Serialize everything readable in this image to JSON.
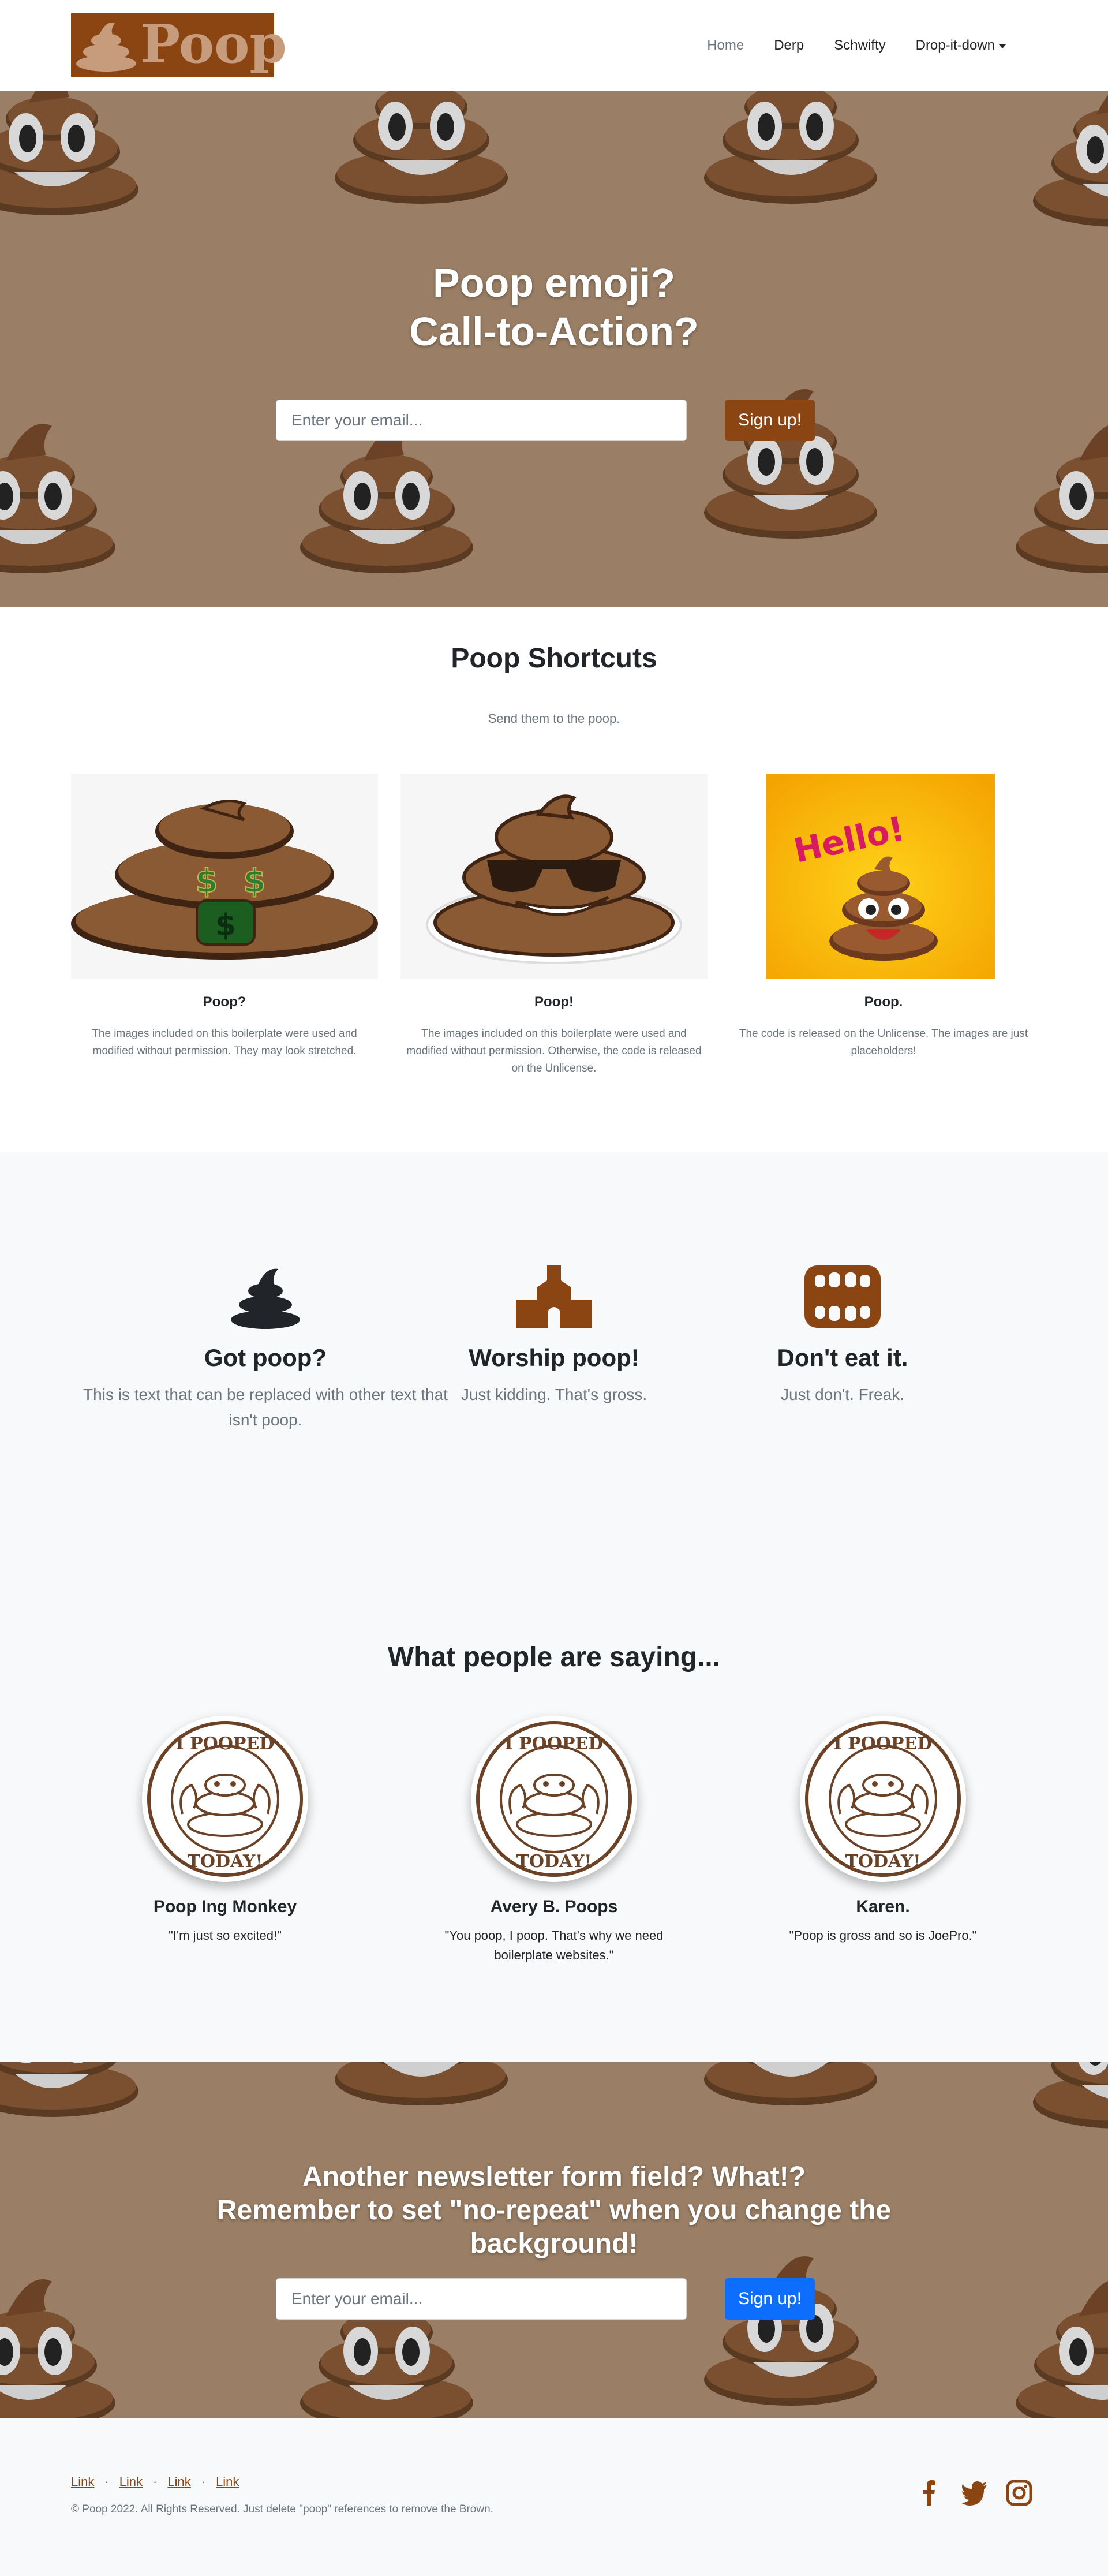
{
  "brand": {
    "logo_text": "Poop"
  },
  "nav": {
    "items": [
      {
        "label": "Home",
        "active": true
      },
      {
        "label": "Derp"
      },
      {
        "label": "Schwifty"
      },
      {
        "label": "Drop-it-down",
        "dropdown": true
      }
    ]
  },
  "hero": {
    "title_line1": "Poop emoji?",
    "title_line2": "Call-to-Action?",
    "email_placeholder": "Enter your email...",
    "button_label": "Sign up!"
  },
  "shortcuts": {
    "title": "Poop Shortcuts",
    "subtitle": "Send them to the poop.",
    "cards": [
      {
        "title": "Poop?",
        "text": "The images included on this boilerplate were used and modified without permission. They may look stretched."
      },
      {
        "title": "Poop!",
        "text": "The images included on this boilerplate were used and modified without permission. Otherwise, the code is released on the Unlicense."
      },
      {
        "title": "Poop.",
        "text": "The code is released on the Unlicense. The images are just placeholders!",
        "image_text": "Hello!"
      }
    ]
  },
  "features": [
    {
      "icon": "poop-icon",
      "title": "Got poop?",
      "text": "This is text that can be replaced with other text that isn't poop."
    },
    {
      "icon": "church-icon",
      "title": "Worship poop!",
      "text": "Just kidding. That's gross."
    },
    {
      "icon": "teeth-icon",
      "title": "Don't eat it.",
      "text": "Just don't. Freak."
    }
  ],
  "testimonials": {
    "title": "What people are saying...",
    "avatar_badge_top": "I POOPED",
    "avatar_badge_bottom": "TODAY!",
    "items": [
      {
        "name": "Poop Ing Monkey",
        "quote": "\"I'm just so excited!\""
      },
      {
        "name": "Avery B. Poops",
        "quote": "\"You poop, I poop. That's why we need boilerplate websites.\""
      },
      {
        "name": "Karen.",
        "quote": "\"Poop is gross and so is JoePro.\""
      }
    ]
  },
  "newsletter": {
    "title_line1": "Another newsletter form field? What!?",
    "title_line2": "Remember to set \"no-repeat\" when you change the",
    "title_line3": "background!",
    "email_placeholder": "Enter your email...",
    "button_label": "Sign up!"
  },
  "footer": {
    "links": [
      "Link",
      "Link",
      "Link",
      "Link"
    ],
    "separator": "·",
    "copyright": "© Poop 2022. All Rights Reserved. Just delete \"poop\" references to remove the Brown.",
    "social": [
      "facebook-icon",
      "twitter-icon",
      "instagram-icon"
    ]
  },
  "colors": {
    "brand_brown": "#8b4513",
    "poop_brown": "#6b4226",
    "hero_bg": "#9a7f66",
    "blue_button": "#0d6efd",
    "muted_text": "#6c757d",
    "gray_section": "#f8f9fa"
  }
}
